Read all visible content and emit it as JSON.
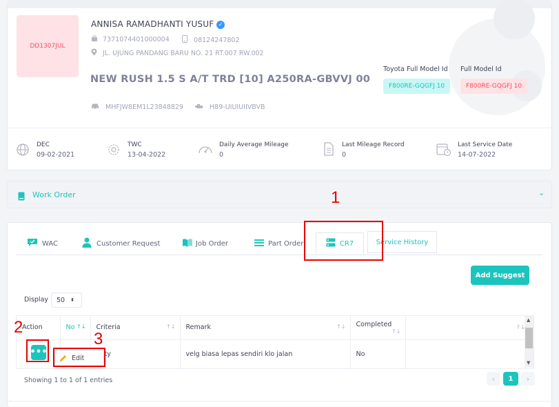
{
  "profile": {
    "plate": "DD1307JUL",
    "name": "ANNISA RAMADHANTI YUSUF",
    "id_number": "7371074401000004",
    "phone": "08124247802",
    "address": "JL. UJUNG PANDANG BARU NO. 21 RT.007 RW.002",
    "model": "NEW RUSH 1.5 S A/T TRD [10] A250RA-GBVVJ 00",
    "vin": "MHFJW8EM1L23848829",
    "engine": "H89-UIUIUIIVBVB",
    "toyota_model_label": "Toyota Full Model Id",
    "toyota_model_value": "F800RE-GQGFJ 10",
    "full_model_label": "Full Model Id",
    "full_model_value": "F800RE-GQGFJ 10"
  },
  "stats": [
    {
      "label": "DEC",
      "value": "09-02-2021",
      "icon": "globe-icon"
    },
    {
      "label": "TWC",
      "value": "13-04-2022",
      "icon": "certificate-icon"
    },
    {
      "label": "Daily Average Mileage",
      "value": "0",
      "icon": "speedometer-icon"
    },
    {
      "label": "Last Mileage Record",
      "value": "0",
      "icon": "document-icon"
    },
    {
      "label": "Last Service Date",
      "value": "14-07-2022",
      "icon": "calendar-icon"
    }
  ],
  "work_order": {
    "title": "Work Order"
  },
  "tabs": [
    {
      "label": "WAC",
      "icon": "wac-icon"
    },
    {
      "label": "Customer Request",
      "icon": "user-icon"
    },
    {
      "label": "Job Order",
      "icon": "book-icon"
    },
    {
      "label": "Part Order",
      "icon": "list-icon"
    },
    {
      "label": "CR7",
      "icon": "server-icon"
    },
    {
      "label": "Service History"
    }
  ],
  "actions": {
    "add_suggest": "Add Suggest"
  },
  "display": {
    "label": "Display",
    "value": "50"
  },
  "table": {
    "headers": [
      "Action",
      "No",
      "Criteria",
      "Remark",
      "Completed",
      ""
    ],
    "rows": [
      {
        "no": "",
        "criteria": "ty",
        "remark": "velg biasa lepas sendiri klo jalan",
        "completed": "No"
      }
    ]
  },
  "dropdown": {
    "edit_label": "Edit"
  },
  "footer": {
    "info": "Showing 1 to 1 of 1 entries",
    "page": "1",
    "prev": "‹",
    "next": "›"
  },
  "annotations": [
    "1",
    "2",
    "3"
  ],
  "colors": {
    "teal": "#1bc5bd",
    "red_annotation": "#e60000",
    "pink_badge": "#ffe2e5"
  }
}
